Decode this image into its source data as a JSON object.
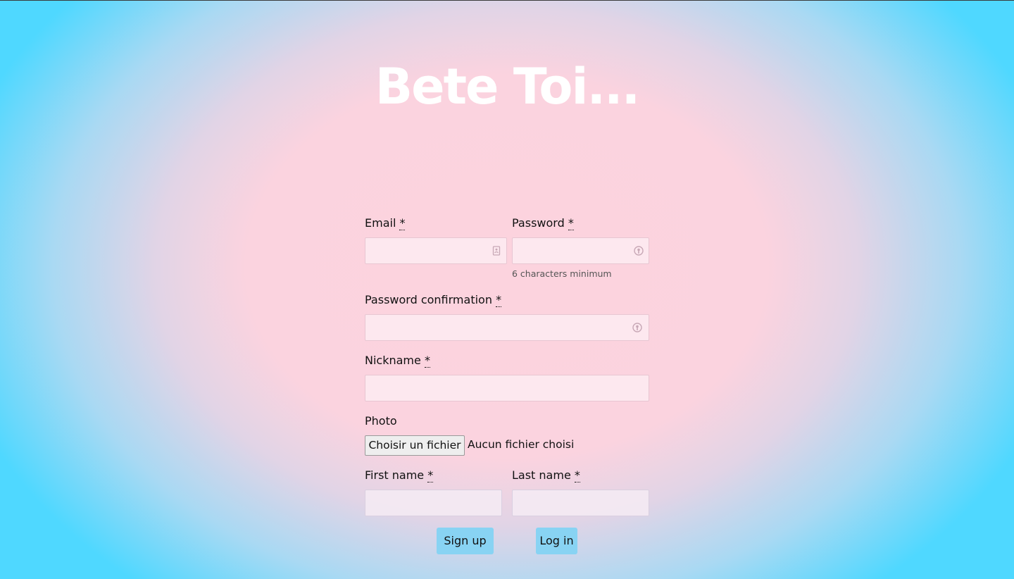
{
  "app": {
    "title": "Bete Toi..."
  },
  "form": {
    "required_marker": "*",
    "email": {
      "label": "Email",
      "value": ""
    },
    "password": {
      "label": "Password",
      "value": "",
      "hint": "6 characters minimum"
    },
    "password_confirmation": {
      "label": "Password confirmation",
      "value": ""
    },
    "nickname": {
      "label": "Nickname",
      "value": ""
    },
    "photo": {
      "label": "Photo",
      "button_label": "Choisir un fichier",
      "status": "Aucun fichier choisi"
    },
    "first_name": {
      "label": "First name",
      "value": ""
    },
    "last_name": {
      "label": "Last name",
      "value": ""
    }
  },
  "actions": {
    "signup_label": "Sign up",
    "login_label": "Log in"
  },
  "icons": {
    "email_icon": "contact-card-icon",
    "password_icon": "key-icon"
  },
  "colors": {
    "button": "#88d3f3",
    "title": "#ffffff",
    "edge": "#4fd8ff",
    "center": "#fcd3de"
  }
}
